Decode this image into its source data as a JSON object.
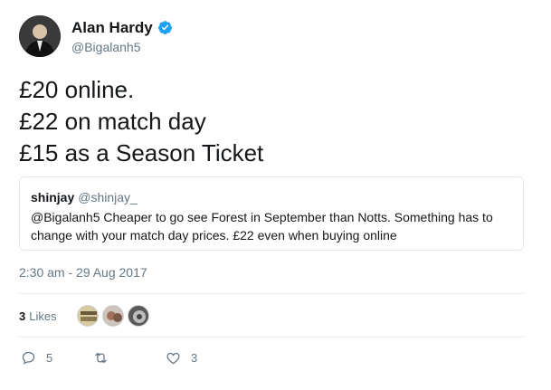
{
  "author": {
    "display_name": "Alan Hardy",
    "handle": "@Bigalanh5",
    "verified": true
  },
  "tweet": {
    "lines": [
      "£20 online.",
      "£22 on match day",
      "£15 as a Season Ticket"
    ]
  },
  "quoted_tweet": {
    "display_name": "shinjay",
    "handle": "@shinjay_",
    "text": "@Bigalanh5 Cheaper to go see Forest in September than Notts. Something has to change with your match day prices. £22 even when buying online"
  },
  "timestamp": "2:30 am - 29 Aug 2017",
  "stats": {
    "likes_count": "3",
    "likes_label": "Likes"
  },
  "actions": {
    "reply_count": "5",
    "retweet_count": "",
    "like_count": "3"
  },
  "colors": {
    "text_primary": "#14171a",
    "text_secondary": "#657786",
    "border": "#e1e8ed",
    "verified_blue": "#1da1f2"
  },
  "icons": {
    "verified": "verified-badge-icon",
    "reply": "reply-icon",
    "retweet": "retweet-icon",
    "like": "heart-icon"
  }
}
